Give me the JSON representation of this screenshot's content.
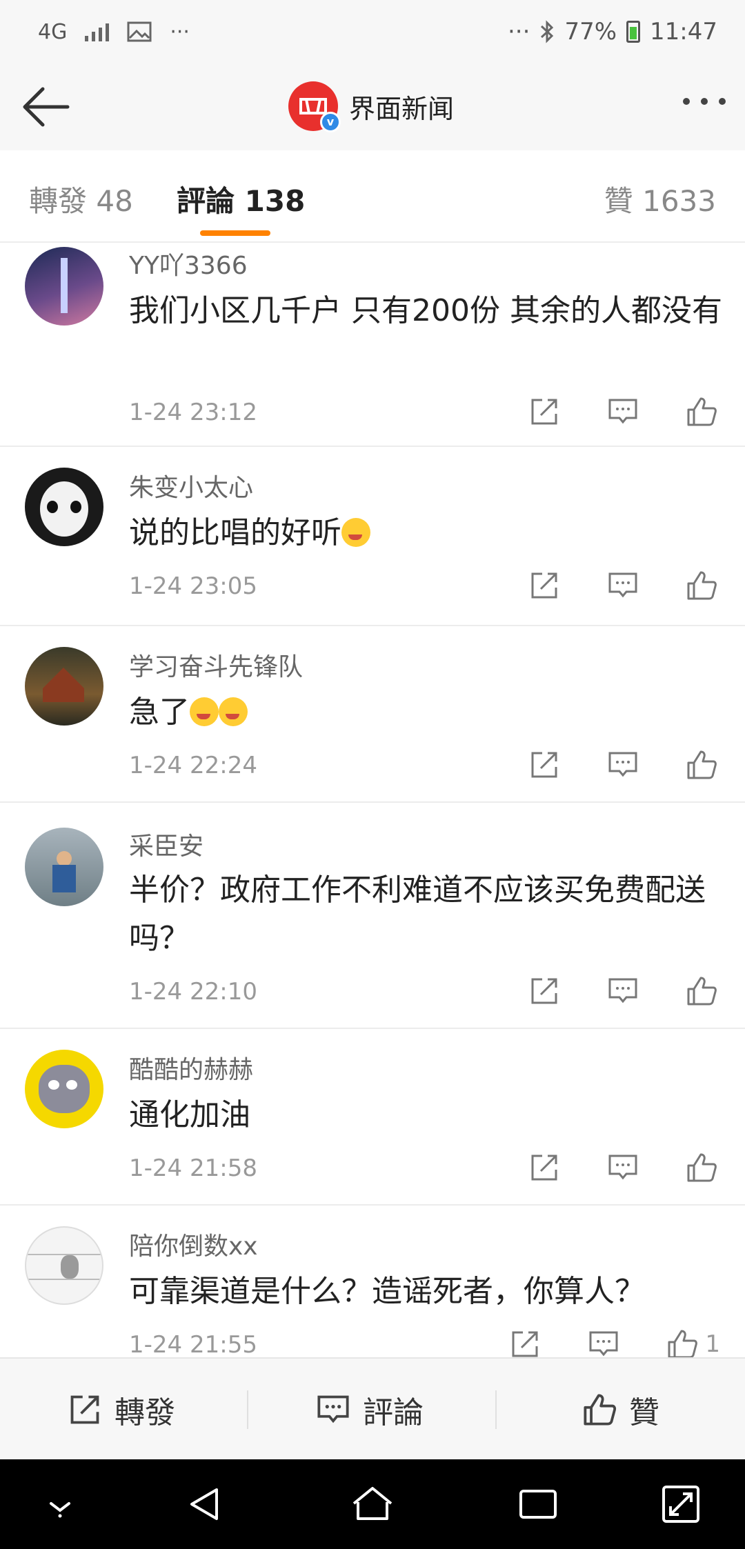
{
  "status_bar": {
    "network": "4G",
    "battery": "77%",
    "time": "11:47"
  },
  "header": {
    "account_name": "界面新闻"
  },
  "tabs": {
    "repost": "轉發 48",
    "comments": "評論 138",
    "likes": "贊 1633"
  },
  "comments": [
    {
      "user": "YY吖3366",
      "text": "我们小区几千户 只有200份 其余的人都没有",
      "time": "1-24 23:12"
    },
    {
      "user": "朱变小太心",
      "text": "说的比唱的好听",
      "time": "1-24 23:05"
    },
    {
      "user": "学习奋斗先锋队",
      "text": "急了",
      "time": "1-24 22:24"
    },
    {
      "user": "采臣安",
      "text": "半价？政府工作不利难道不应该买免费配送吗？",
      "time": "1-24 22:10"
    },
    {
      "user": "酷酷的赫赫",
      "text": "通化加油",
      "time": "1-24 21:58"
    },
    {
      "user": "陪你倒数xx",
      "text": "可靠渠道是什么？造谣死者，你算人？",
      "time": "1-24 21:55",
      "likes": "1"
    }
  ],
  "bottom_bar": {
    "repost_label": "轉發",
    "comment_label": "評論",
    "like_label": "贊"
  },
  "colors": {
    "accent": "#ff8200",
    "brand_red": "#e8302d"
  }
}
